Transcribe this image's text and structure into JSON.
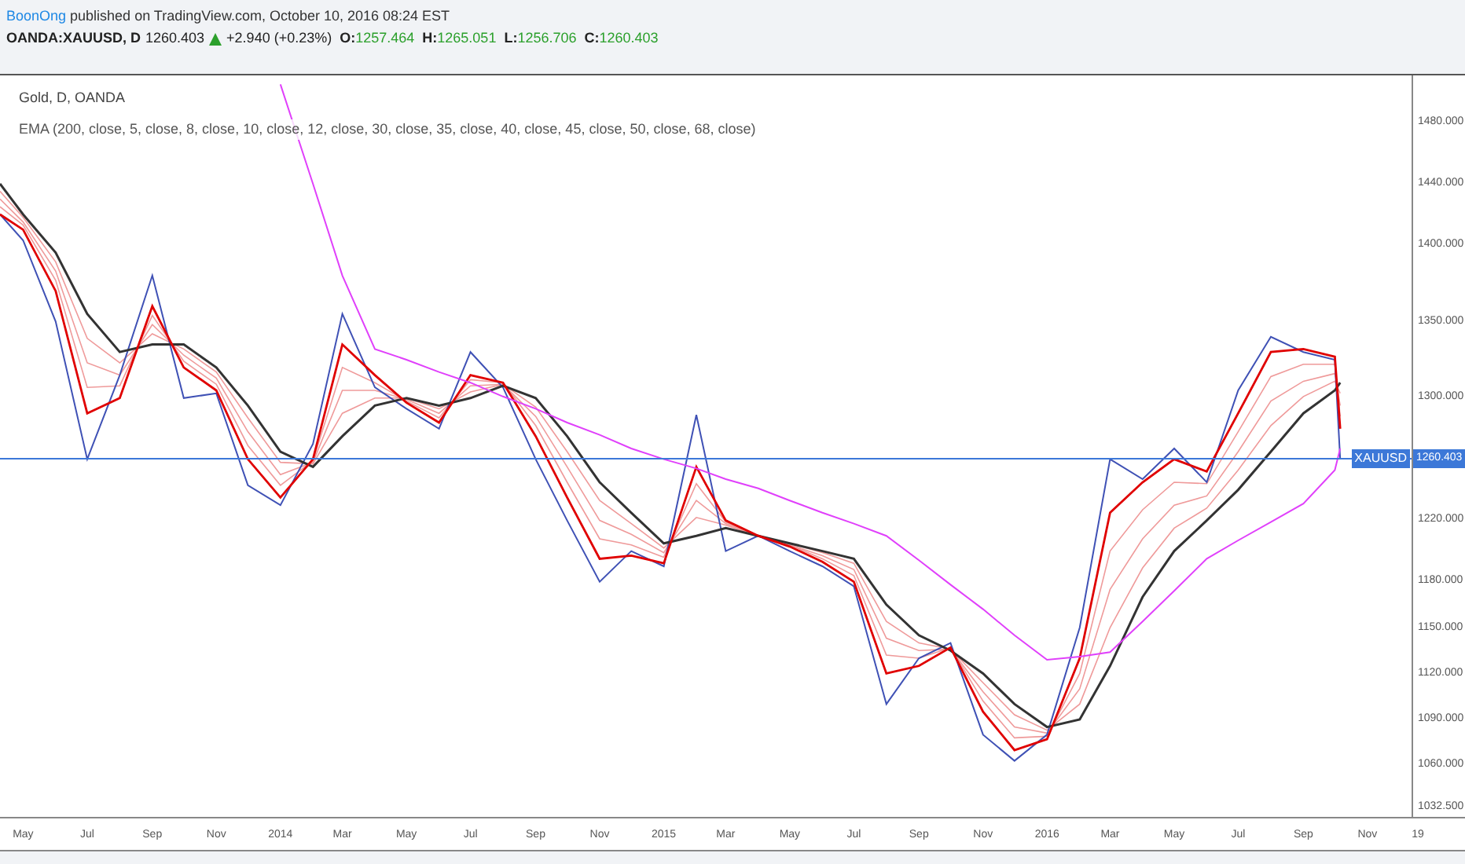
{
  "header": {
    "author": "BoonOng",
    "published": "published on TradingView.com, October 10, 2016 08:24 EST"
  },
  "legend": {
    "symbol": "OANDA:XAUUSD, D",
    "price": "1260.403",
    "change_up": true,
    "change": "+2.940 (+0.23%)",
    "ohlc": [
      {
        "label": "O:",
        "value": "1257.464"
      },
      {
        "label": "H:",
        "value": "1265.051"
      },
      {
        "label": "L:",
        "value": "1256.706"
      },
      {
        "label": "C:",
        "value": "1260.403"
      }
    ]
  },
  "chart": {
    "title": "Gold, D, OANDA",
    "indicator": "EMA (200, close, 5, close, 8, close, 10, close, 12, close, 30, close, 35, close, 40, close, 45, close, 50, close, 68, close)",
    "symbol_tag": "XAUUSD",
    "last_price": "1260.403",
    "chart_data": {
      "type": "line",
      "x": [
        "2013-04-09",
        "2013-05-01",
        "2013-06-01",
        "2013-07-01",
        "2013-08-01",
        "2013-09-01",
        "2013-10-01",
        "2013-11-01",
        "2013-12-01",
        "2014-01-01",
        "2014-02-01",
        "2014-03-01",
        "2014-04-01",
        "2014-05-01",
        "2014-06-01",
        "2014-07-01",
        "2014-08-01",
        "2014-09-01",
        "2014-10-01",
        "2014-11-01",
        "2014-12-01",
        "2015-01-01",
        "2015-02-01",
        "2015-03-01",
        "2015-04-01",
        "2015-05-01",
        "2015-06-01",
        "2015-07-01",
        "2015-08-01",
        "2015-09-01",
        "2015-10-01",
        "2015-11-01",
        "2015-12-01",
        "2016-01-01",
        "2016-02-01",
        "2016-03-01",
        "2016-04-01",
        "2016-05-01",
        "2016-06-01",
        "2016-07-01",
        "2016-08-01",
        "2016-09-01",
        "2016-10-01",
        "2016-10-06"
      ],
      "ref_lines": [
        {
          "axis": "y",
          "value": 1260.403
        }
      ],
      "xlim": [
        "2013-04-09",
        "2016-12-19"
      ],
      "ylim": [
        1025.3,
        1510.8
      ],
      "xticks": [
        {
          "value": "2013-05-01",
          "label": "May"
        },
        {
          "value": "2013-07-01",
          "label": "Jul"
        },
        {
          "value": "2013-09-01",
          "label": "Sep"
        },
        {
          "value": "2013-11-01",
          "label": "Nov"
        },
        {
          "value": "2014-01-01",
          "label": "2014"
        },
        {
          "value": "2014-03-01",
          "label": "Mar"
        },
        {
          "value": "2014-05-01",
          "label": "May"
        },
        {
          "value": "2014-07-01",
          "label": "Jul"
        },
        {
          "value": "2014-09-01",
          "label": "Sep"
        },
        {
          "value": "2014-11-01",
          "label": "Nov"
        },
        {
          "value": "2015-01-01",
          "label": "2015"
        },
        {
          "value": "2015-03-01",
          "label": "Mar"
        },
        {
          "value": "2015-05-01",
          "label": "May"
        },
        {
          "value": "2015-07-01",
          "label": "Jul"
        },
        {
          "value": "2015-09-01",
          "label": "Sep"
        },
        {
          "value": "2015-11-01",
          "label": "Nov"
        },
        {
          "value": "2016-01-01",
          "label": "2016"
        },
        {
          "value": "2016-03-01",
          "label": "Mar"
        },
        {
          "value": "2016-05-01",
          "label": "May"
        },
        {
          "value": "2016-07-01",
          "label": "Jul"
        },
        {
          "value": "2016-09-01",
          "label": "Sep"
        },
        {
          "value": "2016-11-01",
          "label": "Nov"
        },
        {
          "value": "2016-12-19",
          "label": "19"
        }
      ],
      "yticks": [
        {
          "value": 1480,
          "label": "1480.000"
        },
        {
          "value": 1440,
          "label": "1440.000"
        },
        {
          "value": 1400,
          "label": "1400.000"
        },
        {
          "value": 1350,
          "label": "1350.000"
        },
        {
          "value": 1300,
          "label": "1300.000"
        },
        {
          "value": 1220,
          "label": "1220.000"
        },
        {
          "value": 1180,
          "label": "1180.000"
        },
        {
          "value": 1150,
          "label": "1150.000"
        },
        {
          "value": 1120,
          "label": "1120.000"
        },
        {
          "value": 1090,
          "label": "1090.000"
        },
        {
          "value": 1060,
          "label": "1060.000"
        },
        {
          "value": 1032.5,
          "label": "1032.500"
        }
      ],
      "series": [
        {
          "color": "#3f51b5",
          "values": [
            1420,
            1403,
            1350,
            1260,
            1315,
            1380,
            1300,
            1303,
            1243,
            1230,
            1270,
            1355,
            1307,
            1293,
            1280,
            1330,
            1307,
            1260,
            1220,
            1180,
            1200,
            1190,
            1289,
            1200,
            1210,
            1200,
            1190,
            1177,
            1100,
            1130,
            1140,
            1080,
            1063,
            1080,
            1150,
            1260,
            1247,
            1267,
            1245,
            1305,
            1340,
            1330,
            1325,
            1260
          ]
        },
        {
          "color": "#e00000",
          "values": [
            1420,
            1410,
            1370,
            1290,
            1300,
            1360,
            1320,
            1305,
            1260,
            1235,
            1260,
            1335,
            1315,
            1297,
            1284,
            1315,
            1310,
            1275,
            1235,
            1195,
            1197,
            1192,
            1255,
            1220,
            1210,
            1203,
            1193,
            1180,
            1120,
            1125,
            1137,
            1095,
            1070,
            1077,
            1130,
            1225,
            1245,
            1260,
            1252,
            1290,
            1330,
            1332,
            1327,
            1280
          ]
        },
        {
          "color": "#333333",
          "values": [
            1440,
            1420,
            1395,
            1355,
            1330,
            1335,
            1335,
            1320,
            1295,
            1265,
            1255,
            1275,
            1295,
            1300,
            1295,
            1300,
            1308,
            1300,
            1275,
            1245,
            1225,
            1205,
            1210,
            1215,
            1210,
            1205,
            1200,
            1195,
            1165,
            1145,
            1135,
            1120,
            1100,
            1085,
            1090,
            1125,
            1170,
            1200,
            1220,
            1240,
            1265,
            1290,
            1305,
            1310
          ]
        },
        {
          "color": "#ef9a9a",
          "values": [
            1425,
            1413,
            1377,
            1307,
            1308,
            1354,
            1324,
            1309,
            1269,
            1243,
            1259,
            1320,
            1310,
            1298,
            1287,
            1312,
            1310,
            1282,
            1245,
            1208,
            1204,
            1196,
            1244,
            1219,
            1210,
            1204,
            1195,
            1184,
            1132,
            1130,
            1137,
            1102,
            1078,
            1079,
            1120,
            1200,
            1227,
            1245,
            1244,
            1278,
            1314,
            1322,
            1322,
            1288
          ]
        },
        {
          "color": "#ef9a9a",
          "values": [
            1430,
            1415,
            1383,
            1323,
            1315,
            1348,
            1328,
            1313,
            1278,
            1250,
            1258,
            1305,
            1305,
            1299,
            1290,
            1308,
            1309,
            1288,
            1255,
            1220,
            1211,
            1199,
            1233,
            1218,
            1210,
            1204,
            1197,
            1188,
            1143,
            1135,
            1136,
            1108,
            1085,
            1081,
            1110,
            1175,
            1208,
            1230,
            1236,
            1265,
            1298,
            1311,
            1316,
            1295
          ]
        },
        {
          "color": "#ef9a9a",
          "values": [
            1435,
            1418,
            1389,
            1339,
            1323,
            1342,
            1332,
            1317,
            1287,
            1258,
            1257,
            1290,
            1300,
            1300,
            1293,
            1304,
            1309,
            1294,
            1265,
            1233,
            1218,
            1202,
            1222,
            1217,
            1210,
            1205,
            1199,
            1192,
            1154,
            1140,
            1136,
            1114,
            1093,
            1083,
            1100,
            1150,
            1189,
            1215,
            1228,
            1253,
            1282,
            1301,
            1311,
            1303
          ]
        },
        {
          "color": "#e040fb",
          "values": [
            null,
            null,
            null,
            null,
            null,
            null,
            null,
            null,
            null,
            1505,
            1440,
            1380,
            1332,
            1325,
            1317,
            1310,
            1301,
            1293,
            1284,
            1276,
            1267,
            1260,
            1254,
            1247,
            1241,
            1233,
            1225,
            1218,
            1210,
            1194,
            1178,
            1162,
            1145,
            1129,
            1131,
            1134,
            1154,
            1174,
            1195,
            1207,
            1219,
            1231,
            1253,
            1267
          ]
        }
      ]
    }
  }
}
